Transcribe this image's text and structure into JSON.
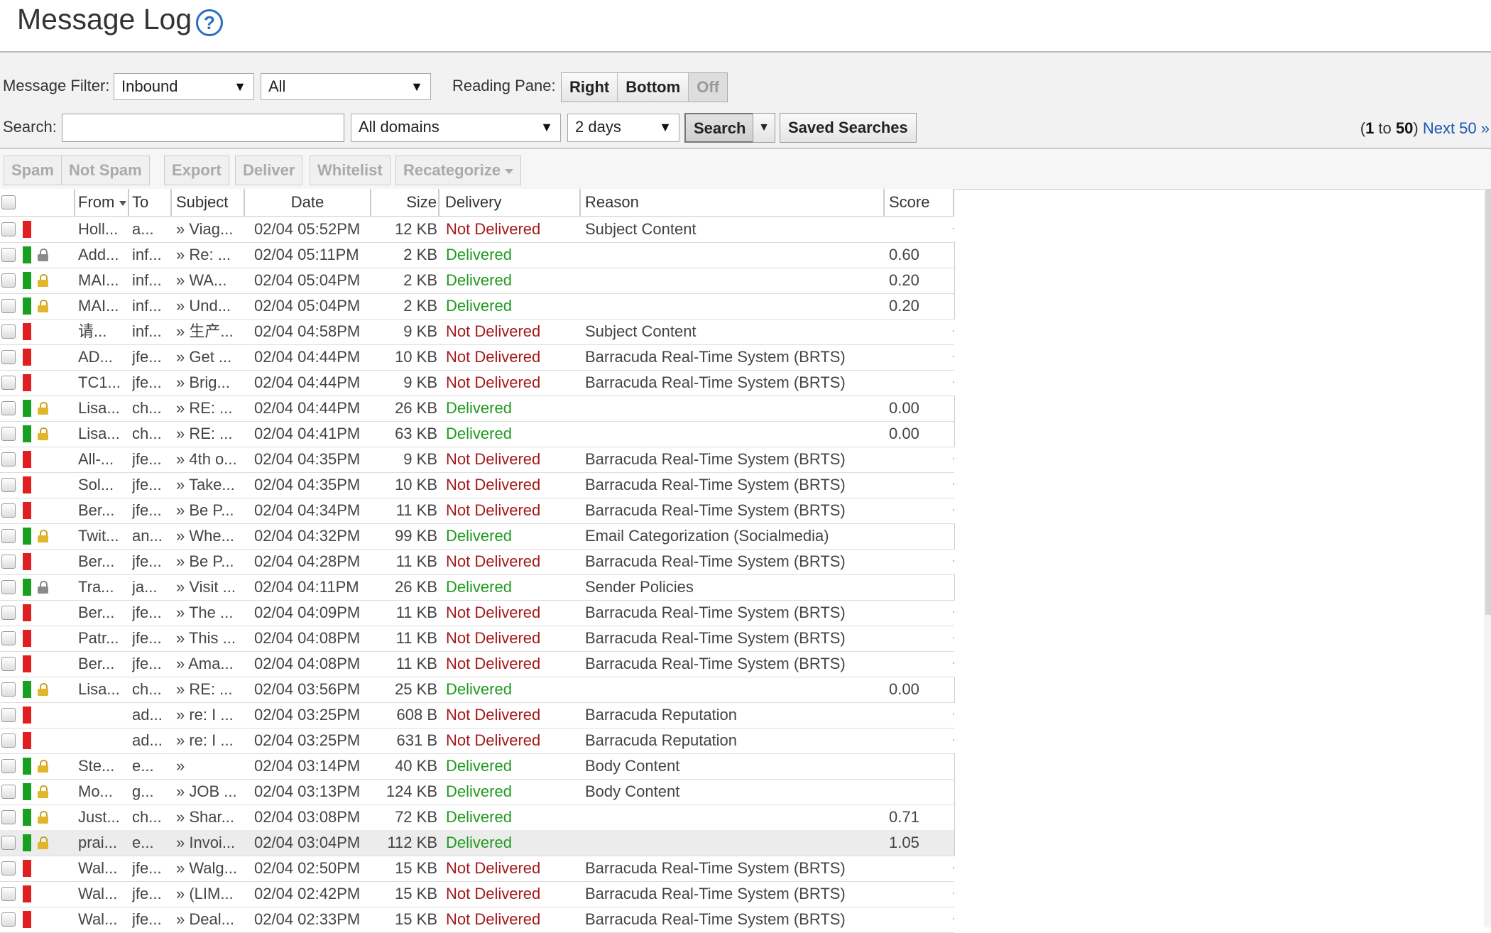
{
  "page": {
    "title": "Message Log",
    "help_icon": "help-icon"
  },
  "filters": {
    "message_filter_label": "Message Filter:",
    "direction": "Inbound",
    "status": "All",
    "reading_pane_label": "Reading Pane:",
    "reading_pane_options": [
      "Right",
      "Bottom",
      "Off"
    ],
    "search_label": "Search:",
    "search_value": "",
    "domain": "All domains",
    "range": "2 days",
    "search_button": "Search",
    "saved_searches_button": "Saved Searches",
    "pager": {
      "open": "(",
      "start": "1",
      "to": " to ",
      "end": "50",
      "close": ")",
      "next": "Next 50 »"
    }
  },
  "actions": {
    "spam": "Spam",
    "not_spam": "Not Spam",
    "export": "Export",
    "deliver": "Deliver",
    "whitelist": "Whitelist",
    "recategorize": "Recategorize"
  },
  "columns": {
    "from": "From",
    "to": "To",
    "subject": "Subject",
    "date": "Date",
    "size": "Size",
    "delivery": "Delivery",
    "reason": "Reason",
    "score": "Score"
  },
  "messages": [
    {
      "flag": "red",
      "lock": "",
      "from": "Holl...",
      "to": "a...",
      "subject": "» Viag...",
      "date": "02/04 05:52PM",
      "size": "12 KB",
      "delivery": "Not Delivered",
      "reason": "Subject Content",
      "score": ""
    },
    {
      "flag": "green",
      "lock": "gray",
      "from": "Add...",
      "to": "inf...",
      "subject": "» Re: ...",
      "date": "02/04 05:11PM",
      "size": "2 KB",
      "delivery": "Delivered",
      "reason": "",
      "score": "0.60"
    },
    {
      "flag": "green",
      "lock": "gold",
      "from": "MAI...",
      "to": "inf...",
      "subject": "» WA...",
      "date": "02/04 05:04PM",
      "size": "2 KB",
      "delivery": "Delivered",
      "reason": "",
      "score": "0.20"
    },
    {
      "flag": "green",
      "lock": "gold",
      "from": "MAI...",
      "to": "inf...",
      "subject": "» Und...",
      "date": "02/04 05:04PM",
      "size": "2 KB",
      "delivery": "Delivered",
      "reason": "",
      "score": "0.20"
    },
    {
      "flag": "red",
      "lock": "",
      "from": "请...",
      "to": "inf...",
      "subject": "» 生产...",
      "date": "02/04 04:58PM",
      "size": "9 KB",
      "delivery": "Not Delivered",
      "reason": "Subject Content",
      "score": ""
    },
    {
      "flag": "red",
      "lock": "",
      "from": "AD...",
      "to": "jfe...",
      "subject": "» Get ...",
      "date": "02/04 04:44PM",
      "size": "10 KB",
      "delivery": "Not Delivered",
      "reason": "Barracuda Real-Time System (BRTS)",
      "score": ""
    },
    {
      "flag": "red",
      "lock": "",
      "from": "TC1...",
      "to": "jfe...",
      "subject": "» Brig...",
      "date": "02/04 04:44PM",
      "size": "9 KB",
      "delivery": "Not Delivered",
      "reason": "Barracuda Real-Time System (BRTS)",
      "score": ""
    },
    {
      "flag": "green",
      "lock": "gold",
      "from": "Lisa...",
      "to": "ch...",
      "subject": "» RE: ...",
      "date": "02/04 04:44PM",
      "size": "26 KB",
      "delivery": "Delivered",
      "reason": "",
      "score": "0.00"
    },
    {
      "flag": "green",
      "lock": "gold",
      "from": "Lisa...",
      "to": "ch...",
      "subject": "» RE: ...",
      "date": "02/04 04:41PM",
      "size": "63 KB",
      "delivery": "Delivered",
      "reason": "",
      "score": "0.00"
    },
    {
      "flag": "red",
      "lock": "",
      "from": "All-...",
      "to": "jfe...",
      "subject": "» 4th o...",
      "date": "02/04 04:35PM",
      "size": "9 KB",
      "delivery": "Not Delivered",
      "reason": "Barracuda Real-Time System (BRTS)",
      "score": ""
    },
    {
      "flag": "red",
      "lock": "",
      "from": "Sol...",
      "to": "jfe...",
      "subject": "» Take...",
      "date": "02/04 04:35PM",
      "size": "10 KB",
      "delivery": "Not Delivered",
      "reason": "Barracuda Real-Time System (BRTS)",
      "score": ""
    },
    {
      "flag": "red",
      "lock": "",
      "from": "Ber...",
      "to": "jfe...",
      "subject": "» Be P...",
      "date": "02/04 04:34PM",
      "size": "11 KB",
      "delivery": "Not Delivered",
      "reason": "Barracuda Real-Time System (BRTS)",
      "score": ""
    },
    {
      "flag": "green",
      "lock": "gold",
      "from": "Twit...",
      "to": "an...",
      "subject": "» Whe...",
      "date": "02/04 04:32PM",
      "size": "99 KB",
      "delivery": "Delivered",
      "reason": "Email Categorization (Socialmedia)",
      "score": ""
    },
    {
      "flag": "red",
      "lock": "",
      "from": "Ber...",
      "to": "jfe...",
      "subject": "» Be P...",
      "date": "02/04 04:28PM",
      "size": "11 KB",
      "delivery": "Not Delivered",
      "reason": "Barracuda Real-Time System (BRTS)",
      "score": ""
    },
    {
      "flag": "green",
      "lock": "gray",
      "from": "Tra...",
      "to": "ja...",
      "subject": "» Visit ...",
      "date": "02/04 04:11PM",
      "size": "26 KB",
      "delivery": "Delivered",
      "reason": "Sender Policies",
      "score": ""
    },
    {
      "flag": "red",
      "lock": "",
      "from": "Ber...",
      "to": "jfe...",
      "subject": "» The ...",
      "date": "02/04 04:09PM",
      "size": "11 KB",
      "delivery": "Not Delivered",
      "reason": "Barracuda Real-Time System (BRTS)",
      "score": ""
    },
    {
      "flag": "red",
      "lock": "",
      "from": "Patr...",
      "to": "jfe...",
      "subject": "» This ...",
      "date": "02/04 04:08PM",
      "size": "11 KB",
      "delivery": "Not Delivered",
      "reason": "Barracuda Real-Time System (BRTS)",
      "score": ""
    },
    {
      "flag": "red",
      "lock": "",
      "from": "Ber...",
      "to": "jfe...",
      "subject": "» Ama...",
      "date": "02/04 04:08PM",
      "size": "11 KB",
      "delivery": "Not Delivered",
      "reason": "Barracuda Real-Time System (BRTS)",
      "score": ""
    },
    {
      "flag": "green",
      "lock": "gold",
      "from": "Lisa...",
      "to": "ch...",
      "subject": "» RE: ...",
      "date": "02/04 03:56PM",
      "size": "25 KB",
      "delivery": "Delivered",
      "reason": "",
      "score": "0.00"
    },
    {
      "flag": "red",
      "lock": "",
      "from": "",
      "to": "ad...",
      "subject": "» re: I ...",
      "date": "02/04 03:25PM",
      "size": "608 B",
      "delivery": "Not Delivered",
      "reason": "Barracuda Reputation",
      "score": ""
    },
    {
      "flag": "red",
      "lock": "",
      "from": "",
      "to": "ad...",
      "subject": "» re: I ...",
      "date": "02/04 03:25PM",
      "size": "631 B",
      "delivery": "Not Delivered",
      "reason": "Barracuda Reputation",
      "score": ""
    },
    {
      "flag": "green",
      "lock": "gold",
      "from": "Ste...",
      "to": "e...",
      "subject": "»",
      "date": "02/04 03:14PM",
      "size": "40 KB",
      "delivery": "Delivered",
      "reason": "Body Content",
      "score": ""
    },
    {
      "flag": "green",
      "lock": "gold",
      "from": "Mo...",
      "to": "g...",
      "subject": "» JOB ...",
      "date": "02/04 03:13PM",
      "size": "124 KB",
      "delivery": "Delivered",
      "reason": "Body Content",
      "score": ""
    },
    {
      "flag": "green",
      "lock": "gold",
      "from": "Just...",
      "to": "ch...",
      "subject": "» Shar...",
      "date": "02/04 03:08PM",
      "size": "72 KB",
      "delivery": "Delivered",
      "reason": "",
      "score": "0.71"
    },
    {
      "flag": "green",
      "lock": "gold",
      "from": "prai...",
      "to": "e...",
      "subject": "» Invoi...",
      "date": "02/04 03:04PM",
      "size": "112 KB",
      "delivery": "Delivered",
      "reason": "",
      "score": "1.05"
    },
    {
      "flag": "red",
      "lock": "",
      "from": "Wal...",
      "to": "jfe...",
      "subject": "» Walg...",
      "date": "02/04 02:50PM",
      "size": "15 KB",
      "delivery": "Not Delivered",
      "reason": "Barracuda Real-Time System (BRTS)",
      "score": ""
    },
    {
      "flag": "red",
      "lock": "",
      "from": "Wal...",
      "to": "jfe...",
      "subject": "» (LIM...",
      "date": "02/04 02:42PM",
      "size": "15 KB",
      "delivery": "Not Delivered",
      "reason": "Barracuda Real-Time System (BRTS)",
      "score": ""
    },
    {
      "flag": "red",
      "lock": "",
      "from": "Wal...",
      "to": "jfe...",
      "subject": "» Deal...",
      "date": "02/04 02:33PM",
      "size": "15 KB",
      "delivery": "Not Delivered",
      "reason": "Barracuda Real-Time System (BRTS)",
      "score": ""
    }
  ],
  "colors": {
    "not_delivered": "#a41a1a",
    "delivered": "#1f9a1f",
    "flag_red": "#e02020",
    "flag_green": "#1aa021",
    "link": "#1a58b0"
  }
}
